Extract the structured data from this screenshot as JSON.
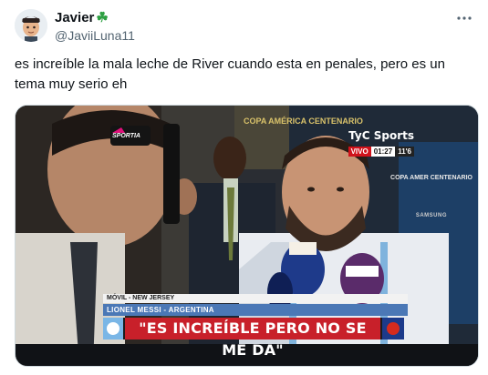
{
  "author": {
    "display_name": "Javier",
    "emoji_icon": "four-leaf-clover-icon",
    "handle": "@JaviiLuna11"
  },
  "post": {
    "text": "es increíble la mala leche de River cuando esta en penales, pero es un tema muy serio eh"
  },
  "media": {
    "broadcaster": "TyC Sports",
    "live_label": "VIVO",
    "clock_time": "01:27",
    "match_minute": "11'6",
    "mic_brand": "SPORTIA",
    "background_banner": "COPA AMÉRICA CENTENARIO",
    "side_banner": "COPA AMER CENTENARIO",
    "sponsor": "SAMSUNG",
    "location_caption": "MÓVIL - NEW JERSEY",
    "name_caption": "LIONEL MESSI - ARGENTINA",
    "quote_caption": "\"ES INCREÍBLE PERO NO SE ME DA\""
  },
  "colors": {
    "caption_red": "#c8202a",
    "caption_blue": "#4b78b6",
    "clover_green": "#2ea043"
  }
}
